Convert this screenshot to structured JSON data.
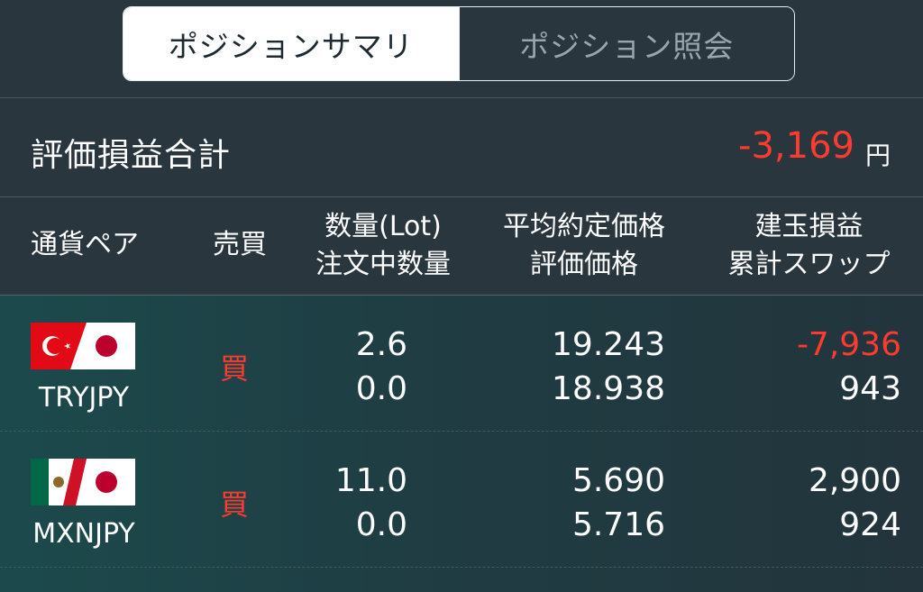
{
  "tabs": [
    {
      "label": "ポジションサマリ",
      "active": true
    },
    {
      "label": "ポジション照会",
      "active": false
    }
  ],
  "total": {
    "label": "評価損益合計",
    "value": "-3,169",
    "unit": "円"
  },
  "header": {
    "pair": "通貨ペア",
    "side": "売買",
    "qty_line1": "数量(Lot)",
    "qty_line2": "注文中数量",
    "price_line1": "平均約定価格",
    "price_line2": "評価価格",
    "pnl_line1": "建玉損益",
    "pnl_line2": "累計スワップ"
  },
  "rows": [
    {
      "flag_icons": [
        "turkey-flag-icon",
        "japan-flag-icon"
      ],
      "pair": "TRYJPY",
      "side": "買",
      "lot": "2.6",
      "pending": "0.0",
      "avg_price": "19.243",
      "eval_price": "18.938",
      "pnl": "-7,936",
      "swap": "943"
    },
    {
      "flag_icons": [
        "mexico-flag-icon",
        "japan-flag-icon"
      ],
      "pair": "MXNJPY",
      "side": "買",
      "lot": "11.0",
      "pending": "0.0",
      "avg_price": "5.690",
      "eval_price": "5.716",
      "pnl": "2,900",
      "swap": "924"
    }
  ],
  "colors": {
    "negative": "#ff3b30",
    "background": "#2a363e",
    "accent_row": "#1c4a4c"
  }
}
